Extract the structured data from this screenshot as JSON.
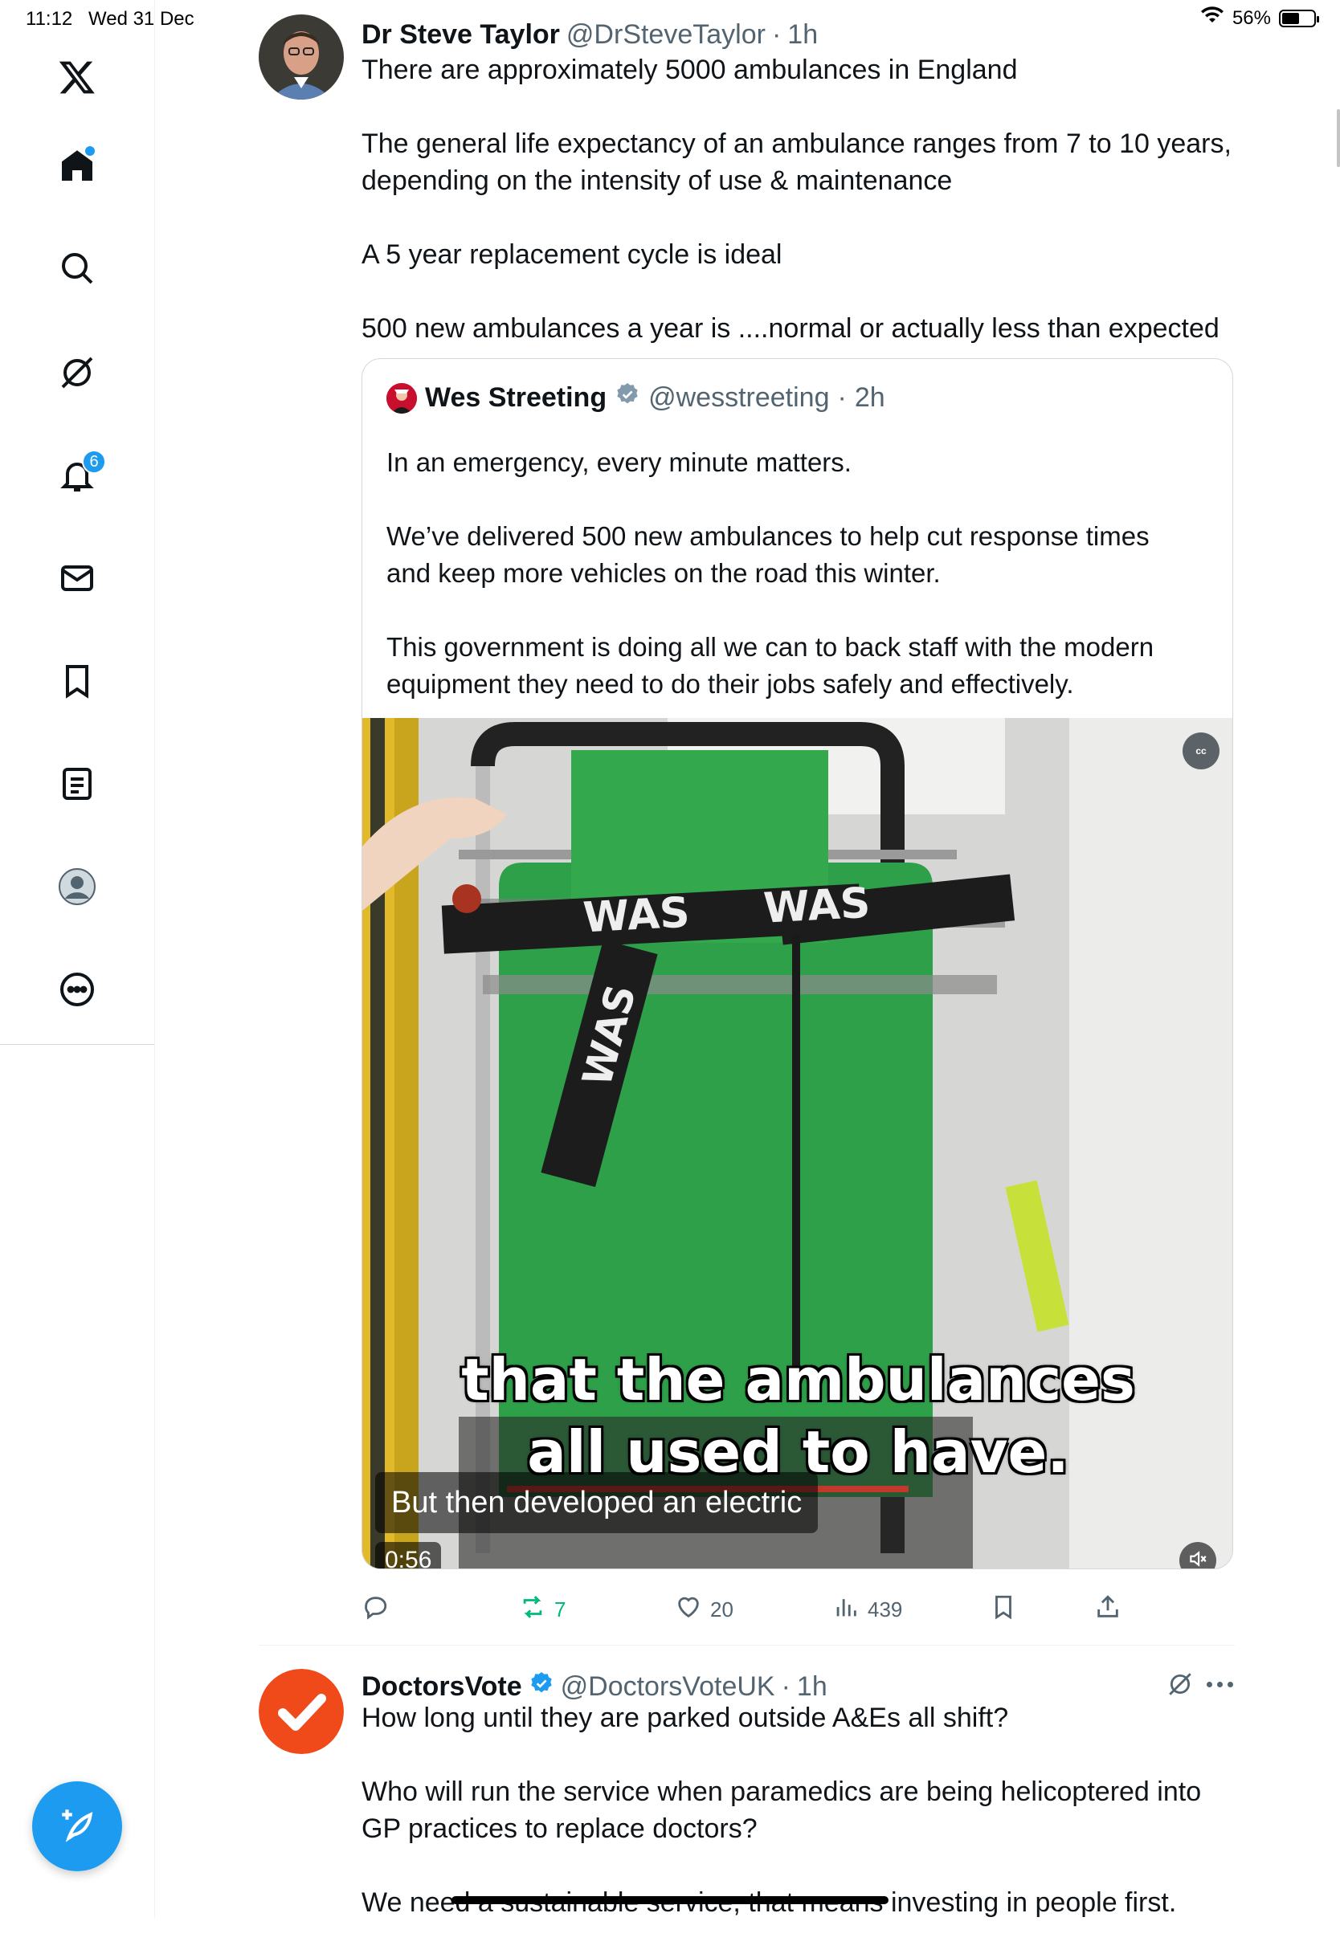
{
  "status_bar": {
    "time": "11:12",
    "date": "Wed 31 Dec",
    "battery_percent": "56%",
    "battery_level": 0.56
  },
  "sidebar": {
    "items": [
      {
        "name": "x-logo",
        "icon": "x-logo-icon"
      },
      {
        "name": "home",
        "icon": "home-icon",
        "has_dot": true
      },
      {
        "name": "explore",
        "icon": "search-icon"
      },
      {
        "name": "grok",
        "icon": "grok-icon"
      },
      {
        "name": "notifications",
        "icon": "bell-icon",
        "badge": "6"
      },
      {
        "name": "messages",
        "icon": "envelope-icon"
      },
      {
        "name": "bookmarks",
        "icon": "bookmark-icon"
      },
      {
        "name": "lists",
        "icon": "list-icon"
      },
      {
        "name": "profile",
        "icon": "profile-icon"
      },
      {
        "name": "more",
        "icon": "more-icon"
      }
    ],
    "compose_icon": "compose-feather-icon"
  },
  "tweet1": {
    "name": "Dr Steve Taylor",
    "handle": "@DrSteveTaylor",
    "separator": "·",
    "ago": "1h",
    "paragraphs": [
      "There are approximately 5000 ambulances in England",
      "The general life expectancy of an ambulance ranges from 7 to 10 years, depending on the intensity of use & maintenance",
      "A 5 year replacement cycle is ideal",
      "500 new ambulances a year is ....normal or actually less than expected"
    ],
    "quote": {
      "name": "Wes Streeting",
      "handle": "@wesstreeting",
      "separator": "·",
      "ago": "2h",
      "paragraphs": [
        "In an emergency, every minute matters.",
        "We’ve delivered 500 new ambulances to help cut response times and keep more vehicles on the road this winter.",
        "This government is doing all we can to back staff with the modern equipment they need to do their jobs safely and effectively."
      ],
      "video": {
        "cc_label": "cc",
        "burned_caption_line1": "that the ambulances",
        "burned_caption_line2": "all used to have.",
        "subtitle": "But then developed an electric",
        "duration": "0:56",
        "strap_text": "WAS"
      }
    },
    "actions": {
      "reply": "",
      "retweet": "7",
      "like": "20",
      "views": "439"
    },
    "colors": {
      "retweet_active": "#00ba7c"
    }
  },
  "tweet2": {
    "name": "DoctorsVote",
    "handle": "@DoctorsVoteUK",
    "separator": "·",
    "ago": "1h",
    "paragraphs": [
      "How long until they are parked outside A&Es all shift?",
      "Who will run the service when paramedics are being helicoptered into GP practices to replace doctors?",
      "We need a sustainable service, that means investing in people first."
    ],
    "colors": {
      "avatar_bg": "#f04a1a"
    }
  }
}
